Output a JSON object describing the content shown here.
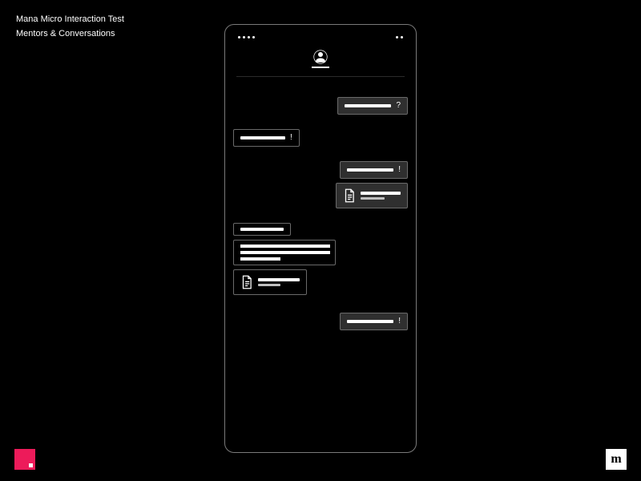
{
  "header": {
    "title": "Mana Micro Interaction Test",
    "subtitle": "Mentors & Conversations"
  },
  "brand": {
    "accent_color": "#ed1b5a",
    "logo_letter": "m"
  },
  "chat": {
    "messages": [
      {
        "side": "right",
        "style": "dark",
        "type": "text",
        "trail": "?"
      },
      {
        "side": "left",
        "style": "black",
        "type": "text",
        "trail": "!"
      },
      {
        "side": "right",
        "style": "dark",
        "type": "text",
        "trail": "!"
      },
      {
        "side": "right",
        "style": "dark",
        "type": "attachment"
      },
      {
        "side": "left",
        "style": "black",
        "type": "text"
      },
      {
        "side": "left",
        "style": "black",
        "type": "multiline"
      },
      {
        "side": "left",
        "style": "black",
        "type": "attachment"
      },
      {
        "side": "right",
        "style": "dark",
        "type": "text",
        "trail": "!"
      }
    ]
  }
}
